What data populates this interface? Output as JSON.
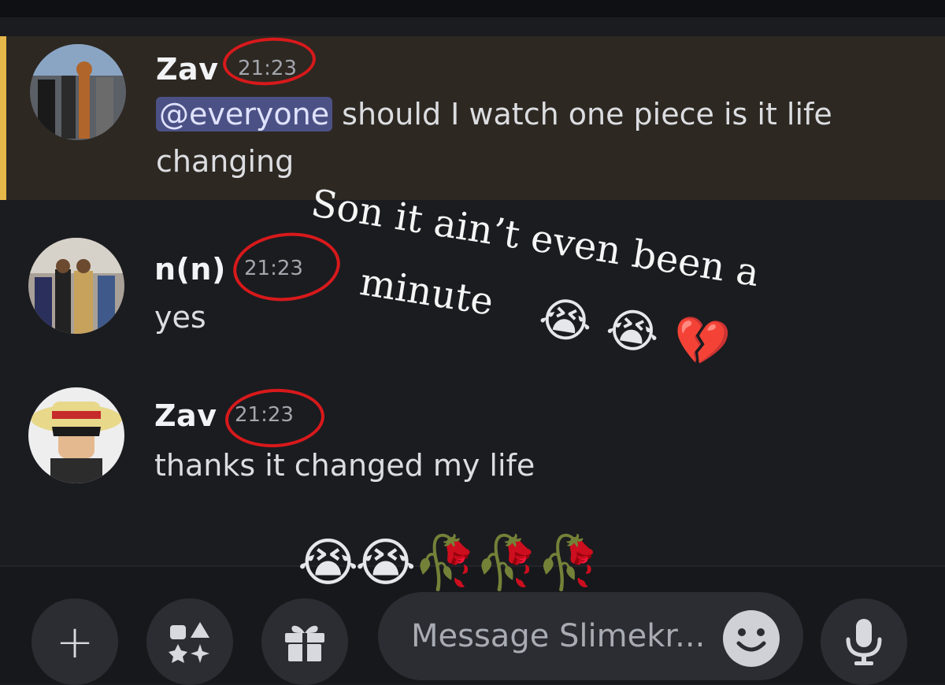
{
  "messages": [
    {
      "author": "Zav",
      "time": "21:23",
      "mention": "@everyone",
      "text_line1": "should I watch one piece is it life",
      "text_line2": "changing"
    },
    {
      "author": "n(n)",
      "time": "21:23",
      "text": "yes"
    },
    {
      "author": "Zav",
      "time": "21:23",
      "text": "thanks it changed my life"
    }
  ],
  "overlay": {
    "line1": "Son it ain’t even been a",
    "line2": "minute",
    "line2_emojis": "😭 😭 💔",
    "bottom_emojis": "😭😭🥀🥀🥀"
  },
  "composer": {
    "placeholder": "Message Slimekr...",
    "plus_icon": "+"
  },
  "colors": {
    "highlight_bg": "#2d2822",
    "highlight_border": "#e6b84a",
    "mention_bg": "#4c5185",
    "circle_annotation": "#d8191b"
  }
}
